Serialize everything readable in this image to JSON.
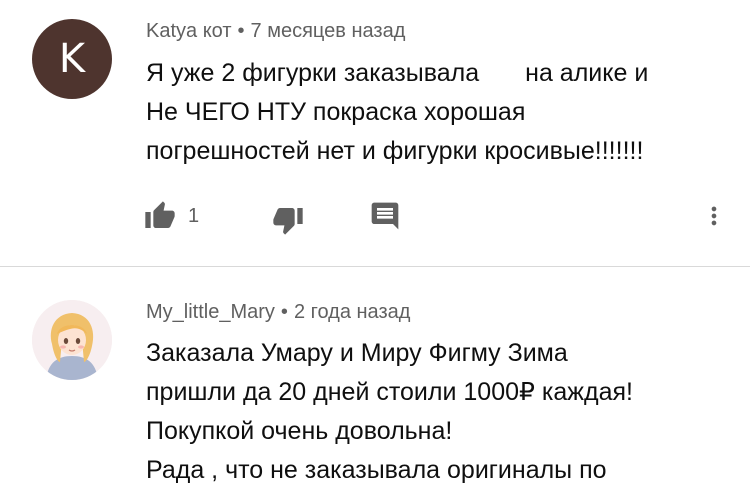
{
  "colors": {
    "avatar_bg": "#4e342e",
    "icon": "#606060"
  },
  "comments": [
    {
      "avatar_letter": "K",
      "author": "Katya кот",
      "separator": "•",
      "time": "7 месяцев назад",
      "lines": [
        "Я уже 2 фигурки заказывала",
        "на алике  и",
        "Не ЧЕГО НТУ покраска хорошая",
        "погрешностей нет и фигурки кросивые!!!!!!!"
      ],
      "likes": "1",
      "icons": [
        "thumb-up-icon",
        "thumb-down-icon",
        "reply-icon",
        "more-vert-icon"
      ]
    },
    {
      "avatar_image": "avatar-illustration-girl",
      "author": "My_little_Mary",
      "separator": "•",
      "time": "2 года назад",
      "lines": [
        "Заказала Умару и Миру Фигму Зима",
        "пришли да 20 дней стоили 1000₽ каждая!",
        "Покупкой очень довольна!",
        "Рада , что не заказывала оригиналы по"
      ]
    }
  ]
}
